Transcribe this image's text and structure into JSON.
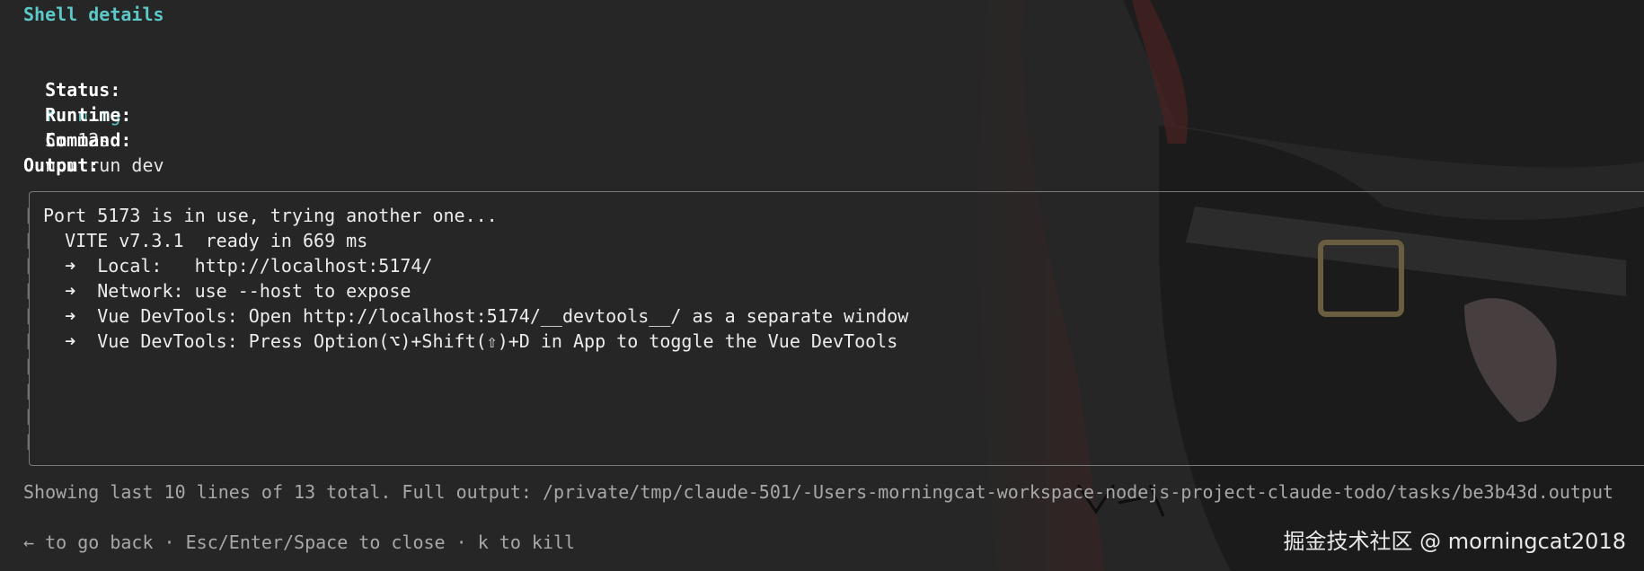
{
  "title": "Shell details",
  "details": {
    "status_label": "Status:",
    "status_value": "running",
    "runtime_label": "Runtime:",
    "runtime_value": "5m 12s",
    "command_label": "Command:",
    "command_value": "npm run dev"
  },
  "output": {
    "label": "Output:",
    "lines": [
      "Port 5173 is in use, trying another one...",
      "  VITE v7.3.1  ready in 669 ms",
      "  ➜  Local:   http://localhost:5174/",
      "  ➜  Network: use --host to expose",
      "  ➜  Vue DevTools: Open http://localhost:5174/__devtools__/ as a separate window",
      "  ➜  Vue DevTools: Press Option(⌥)+Shift(⇧)+D in App to toggle the Vue DevTools"
    ]
  },
  "summary": "Showing last 10 lines of 13 total. Full output: /private/tmp/claude-501/-Users-morningcat-workspace-nodejs-project-claude-todo/tasks/be3b43d.output",
  "shortcuts": "← to go back · Esc/Enter/Space to close · k to kill",
  "watermark": "掘金技术社区 @ morningcat2018",
  "colors": {
    "background": "#262626",
    "accent": "#5cc8c8",
    "text": "#e6e6e6",
    "muted": "#a8a8a8"
  }
}
